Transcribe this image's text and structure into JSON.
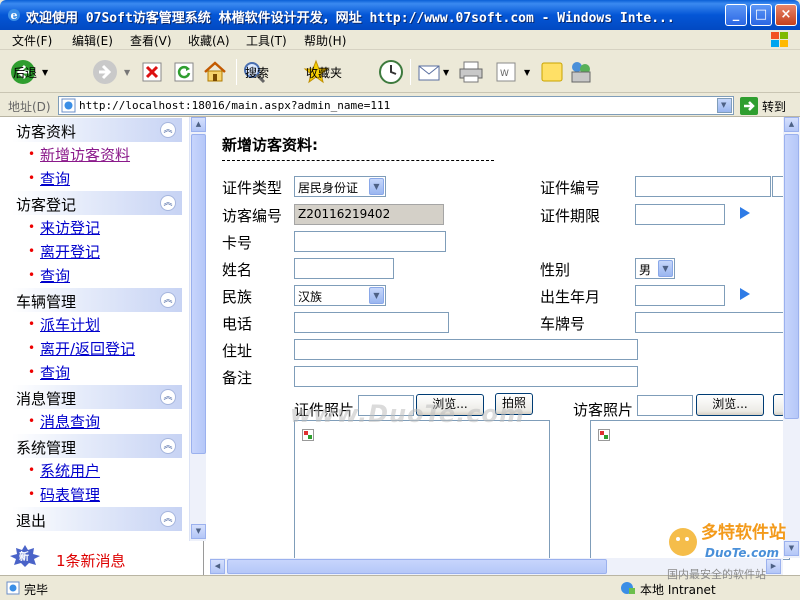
{
  "window": {
    "title": "欢迎使用 07Soft访客管理系统  林楷软件设计开发，网址 http://www.07soft.com - Windows Inte...",
    "buttons": {
      "minimize": "_",
      "maximize": "□",
      "close": "×"
    }
  },
  "menu": [
    "文件(F)",
    "编辑(E)",
    "查看(V)",
    "收藏(A)",
    "工具(T)",
    "帮助(H)"
  ],
  "toolbar": {
    "back": "后退",
    "search": "搜索",
    "favorites": "收藏夹"
  },
  "address": {
    "label": "地址(D)",
    "url": "http://localhost:18016/main.aspx?admin_name=111",
    "go": "转到"
  },
  "sidebar": {
    "sections": [
      {
        "title": "访客资料",
        "items": [
          "新增访客资料",
          "查询"
        ]
      },
      {
        "title": "访客登记",
        "items": [
          "来访登记",
          "离开登记",
          "查询"
        ]
      },
      {
        "title": "车辆管理",
        "items": [
          "派车计划",
          "离开/返回登记",
          "查询"
        ]
      },
      {
        "title": "消息管理",
        "items": [
          "消息查询"
        ]
      },
      {
        "title": "系统管理",
        "items": [
          "系统用户",
          "码表管理"
        ]
      },
      {
        "title": "退出",
        "items": []
      }
    ],
    "new_badge": "新",
    "new_message": "1条新消息"
  },
  "form": {
    "title": "新增访客资料:",
    "labels": {
      "id_type": "证件类型",
      "id_no": "证件编号",
      "visitor_no": "访客编号",
      "id_expiry": "证件期限",
      "card_no": "卡号",
      "name": "姓名",
      "gender": "性别",
      "ethnicity": "民族",
      "birth": "出生年月",
      "phone": "电话",
      "plate": "车牌号",
      "address": "住址",
      "remark": "备注",
      "id_photo": "证件照片",
      "visitor_photo": "访客照片"
    },
    "values": {
      "id_type": "居民身份证",
      "visitor_no": "Z20116219402",
      "gender": "男",
      "ethnicity": "汉族"
    },
    "buttons": {
      "browse": "浏览...",
      "capture": "拍照"
    }
  },
  "status": {
    "text": "完毕",
    "zone": "本地 Intranet"
  },
  "watermark": "www.DuoTe.com",
  "corner_logo": {
    "name": "多特软件站",
    "url": "DuoTe.com",
    "slogan": "国内最安全的软件站"
  }
}
